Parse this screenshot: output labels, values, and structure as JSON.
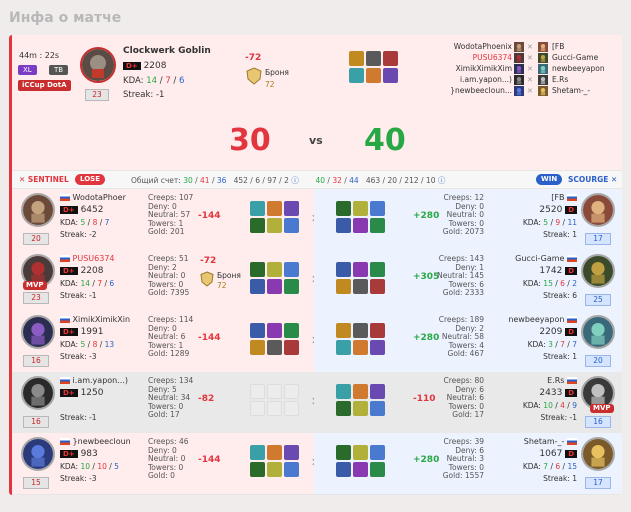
{
  "page": {
    "title": "Инфа о матче"
  },
  "summary": {
    "duration": "44m : 22s",
    "badges": [
      "XL",
      "TB"
    ],
    "league": "iCCup DotA",
    "hero": "Clockwerk Goblin",
    "rank_letter": "D+",
    "rating": "2208",
    "kda_label": "KDA:",
    "kda": [
      "14",
      "7",
      "6"
    ],
    "streak": "Streak: -1",
    "level": "23",
    "delta": "-72",
    "item": "Броня",
    "item_val": "72",
    "score_left": "30",
    "vs": "vs",
    "score_right": "40",
    "left_names": [
      "WodotaPhoenix",
      "PUSU6374",
      "XimikXimikXim",
      "i.am.yapon...)",
      "}newbeecloun..."
    ],
    "right_names": [
      "[FB",
      "Gucci-Game",
      "newbeeyapon",
      "E.Rs",
      "Shetam-_-"
    ]
  },
  "header": {
    "sentinel": "SENTINEL",
    "lose": "LOSE",
    "total": "Общий счет:",
    "s1": "30",
    "s2": "41",
    "s3": "36",
    "mid1": "452 / 6 / 97 / 2",
    "r1": "40",
    "r2": "32",
    "r3": "44",
    "mid2": "463 / 20 / 212 / 10",
    "win": "WIN",
    "scourge": "SCOURGE"
  },
  "rows": [
    {
      "l": {
        "name": "WodotaPhoer",
        "rating": "6452",
        "kda": [
          "5",
          "8",
          "7"
        ],
        "streak": "Streak: -2",
        "lvl": "20",
        "creeps": "Creeps: 107",
        "deny": "Deny: 0",
        "neutral": "Neutral: 57",
        "towers": "Towers: 1",
        "gold": "Gold: 201",
        "delta": "-144",
        "mvp": ""
      },
      "r": {
        "name": "[FB",
        "rating": "2520",
        "kda": [
          "5",
          "9",
          "11"
        ],
        "streak": "Streak: 1",
        "lvl": "17",
        "creeps": "Creeps: 12",
        "deny": "Deny: 0",
        "neutral": "Neutral: 0",
        "towers": "Towers: 0",
        "gold": "Gold: 2073",
        "delta": "+280",
        "mvp": ""
      }
    },
    {
      "l": {
        "name": "PUSU6374",
        "rating": "2208",
        "kda": [
          "14",
          "7",
          "6"
        ],
        "streak": "Streak: -1",
        "lvl": "23",
        "creeps": "Creeps: 51",
        "deny": "Deny: 2",
        "neutral": "Neutral: 0",
        "towers": "Towers: 0",
        "gold": "Gold: 7395",
        "delta": "-72",
        "mvp": "MVP",
        "item": "Броня",
        "item_val": "72"
      },
      "r": {
        "name": "Gucci-Game",
        "rating": "1742",
        "kda": [
          "15",
          "6",
          "2"
        ],
        "streak": "Streak: 6",
        "lvl": "25",
        "creeps": "Creeps: 143",
        "deny": "Deny: 1",
        "neutral": "Neutral: 145",
        "towers": "Towers: 6",
        "gold": "Gold: 2333",
        "delta": "+305",
        "mvp": ""
      }
    },
    {
      "l": {
        "name": "XimikXimikXin",
        "rating": "1991",
        "kda": [
          "5",
          "8",
          "13"
        ],
        "streak": "Streak: -3",
        "lvl": "16",
        "creeps": "Creeps: 114",
        "deny": "Deny: 0",
        "neutral": "Neutral: 6",
        "towers": "Towers: 1",
        "gold": "Gold: 1289",
        "delta": "-144",
        "mvp": ""
      },
      "r": {
        "name": "newbeeyapon",
        "rating": "2209",
        "kda": [
          "3",
          "7",
          "7"
        ],
        "streak": "Streak: 1",
        "lvl": "20",
        "creeps": "Creeps: 189",
        "deny": "Deny: 2",
        "neutral": "Neutral: 58",
        "towers": "Towers: 4",
        "gold": "Gold: 467",
        "delta": "+280",
        "mvp": ""
      }
    },
    {
      "l": {
        "name": "i.am.yapon...)",
        "rating": "1250",
        "kda": [],
        "streak": "Streak: -1",
        "lvl": "16",
        "creeps": "Creeps: 134",
        "deny": "Deny: 5",
        "neutral": "Neutral: 34",
        "towers": "Towers: 0",
        "gold": "Gold: 17",
        "delta": "-82",
        "mvp": ""
      },
      "r": {
        "name": "E.Rs",
        "rating": "2433",
        "kda": [
          "10",
          "4",
          "9"
        ],
        "streak": "Streak: -1",
        "lvl": "16",
        "creeps": "Creeps: 80",
        "deny": "Deny: 6",
        "neutral": "Neutral: 6",
        "towers": "Towers: 0",
        "gold": "Gold: 17",
        "delta": "-110",
        "mvp": "MVP"
      }
    },
    {
      "l": {
        "name": "}newbeecloun",
        "rating": "983",
        "kda": [
          "10",
          "10",
          "5"
        ],
        "streak": "Streak: -3",
        "lvl": "15",
        "creeps": "Creeps: 46",
        "deny": "Deny: 0",
        "neutral": "Neutral: 0",
        "towers": "Towers: 0",
        "gold": "Gold: 0",
        "delta": "-144",
        "mvp": ""
      },
      "r": {
        "name": "Shetam-_-",
        "rating": "1067",
        "kda": [
          "7",
          "6",
          "15"
        ],
        "streak": "Streak: 1",
        "lvl": "17",
        "creeps": "Creeps: 39",
        "deny": "Deny: 6",
        "neutral": "Neutral: 3",
        "towers": "Towers: 0",
        "gold": "Gold: 1557",
        "delta": "+280",
        "mvp": ""
      }
    }
  ],
  "colors": {
    "lose": "#e2363f",
    "win": "#28a745",
    "scourge": "#2b60c9"
  }
}
